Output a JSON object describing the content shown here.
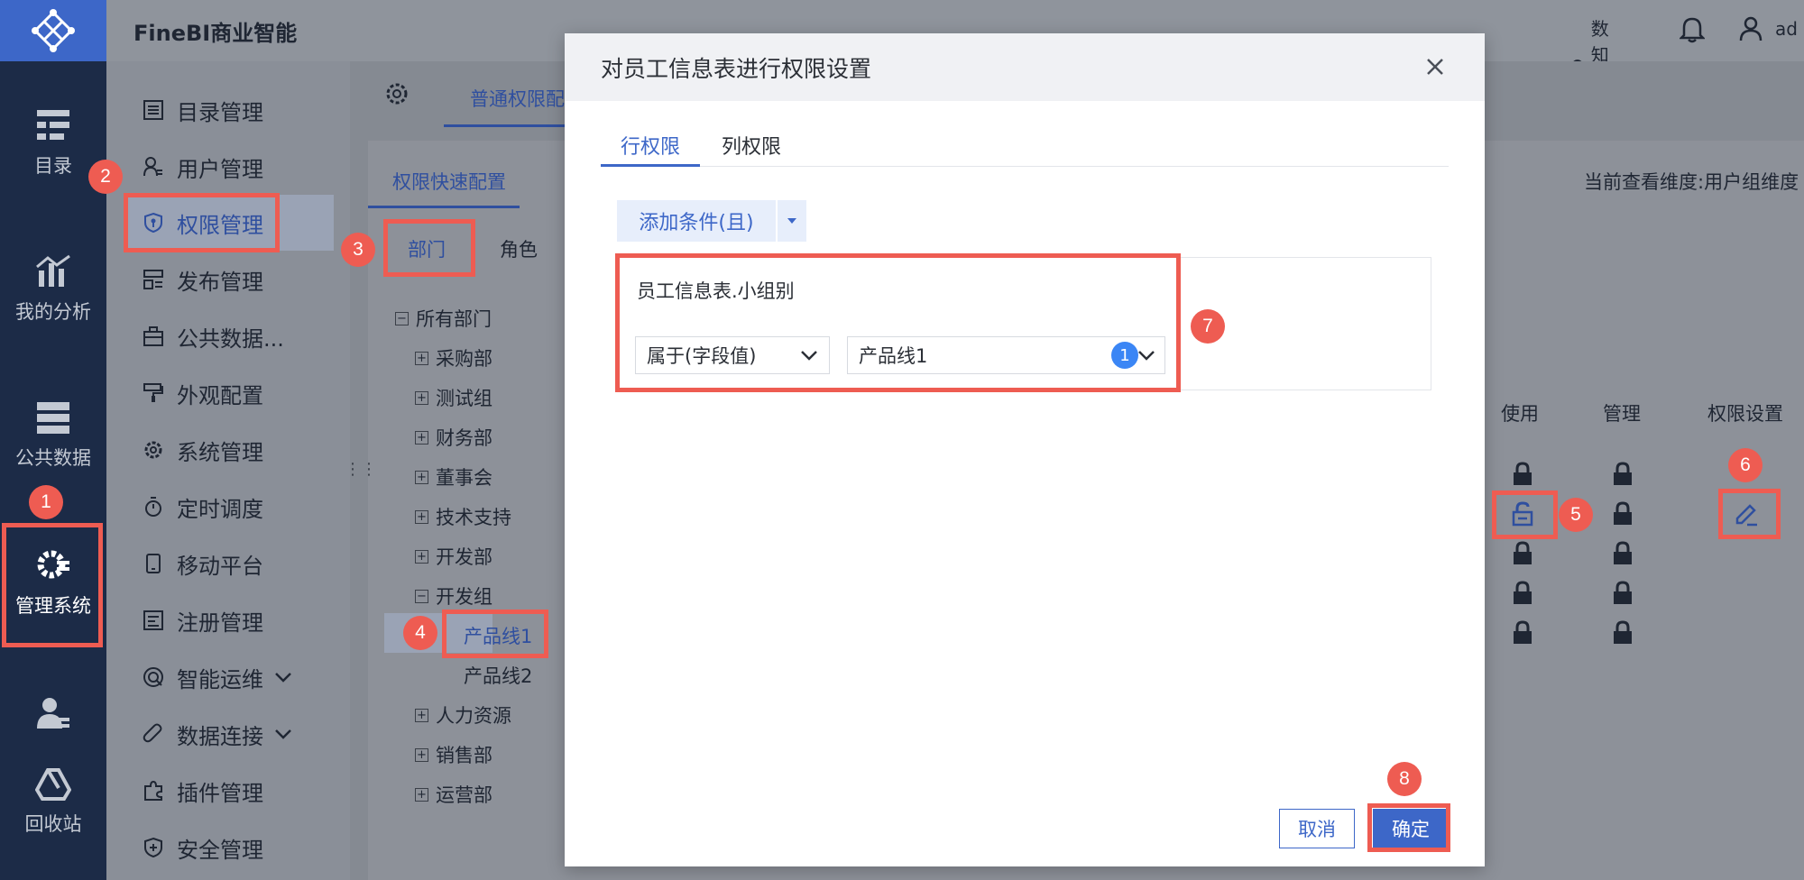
{
  "app": {
    "title": "FineBI商业智能",
    "ai_label": "数知鸟AI",
    "user": "ad"
  },
  "rail": {
    "items": [
      {
        "label": "目录",
        "icon": "catalog-icon"
      },
      {
        "label": "我的分析",
        "icon": "analysis-icon"
      },
      {
        "label": "公共数据",
        "icon": "public-data-icon"
      },
      {
        "label": "管理系统",
        "icon": "gear-icon"
      },
      {
        "label": "",
        "icon": "user-icon"
      },
      {
        "label": "回收站",
        "icon": "recycle-icon"
      }
    ]
  },
  "menu": {
    "items": [
      {
        "label": "目录管理"
      },
      {
        "label": "用户管理"
      },
      {
        "label": "权限管理"
      },
      {
        "label": "发布管理"
      },
      {
        "label": "公共数据..."
      },
      {
        "label": "外观配置"
      },
      {
        "label": "系统管理"
      },
      {
        "label": "定时调度"
      },
      {
        "label": "移动平台"
      },
      {
        "label": "注册管理"
      },
      {
        "label": "智能运维"
      },
      {
        "label": "数据连接"
      },
      {
        "label": "插件管理"
      },
      {
        "label": "安全管理"
      }
    ]
  },
  "content": {
    "top_tab": "普通权限配",
    "sub_tab": "权限快速配置",
    "dimension_text": "当前查看维度:用户组维度",
    "scope_tabs": [
      "部门",
      "角色"
    ],
    "tree": {
      "root": "所有部门",
      "nodes": [
        "采购部",
        "测试组",
        "财务部",
        "董事会",
        "技术支持",
        "开发部",
        "开发组"
      ],
      "children": [
        "产品线1",
        "产品线2"
      ],
      "after": [
        "人力资源",
        "销售部",
        "运营部"
      ]
    },
    "columns": [
      "使用",
      "管理",
      "权限设置"
    ]
  },
  "modal": {
    "title": "对员工信息表进行权限设置",
    "tabs": [
      "行权限",
      "列权限"
    ],
    "add_condition": "添加条件(且)",
    "field": "员工信息表.小组别",
    "operator": "属于(字段值)",
    "value": "产品线1",
    "value_count": "1",
    "cancel": "取消",
    "ok": "确定"
  },
  "annotations": [
    "1",
    "2",
    "3",
    "4",
    "5",
    "6",
    "7",
    "8"
  ],
  "colors": {
    "accent": "#3d67c8",
    "marker": "#ee5c52",
    "rail": "#1c2b47"
  }
}
